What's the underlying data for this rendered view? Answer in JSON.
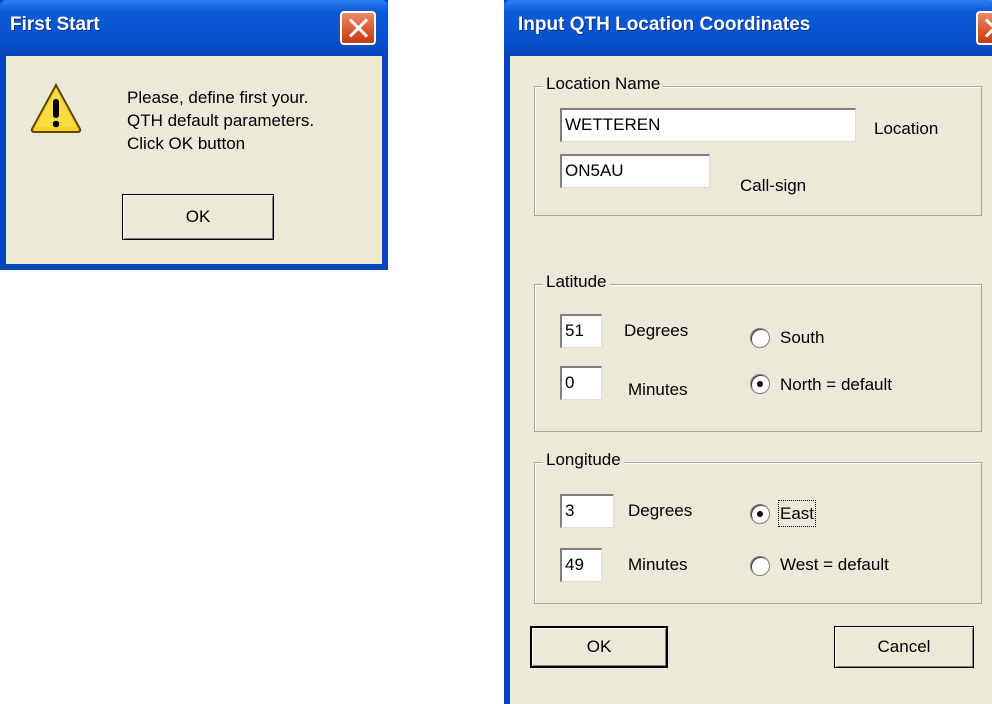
{
  "dialog1": {
    "title": "First Start",
    "message": [
      "Please, define first your.",
      "QTH default parameters.",
      "Click OK button"
    ],
    "ok_label": "OK"
  },
  "dialog2": {
    "title": "Input QTH Location Coordinates",
    "location_group": {
      "legend": "Location Name",
      "location_value": "WETTEREN",
      "location_label": "Location",
      "callsign_value": "ON5AU",
      "callsign_label": "Call-sign"
    },
    "latitude_group": {
      "legend": "Latitude",
      "degrees_value": "51",
      "degrees_label": "Degrees",
      "minutes_value": "0",
      "minutes_label": "Minutes",
      "south_label": "South",
      "north_label": "North = default",
      "selected": "north"
    },
    "longitude_group": {
      "legend": "Longitude",
      "degrees_value": "3",
      "degrees_label": "Degrees",
      "minutes_value": "49",
      "minutes_label": "Minutes",
      "east_label": "East",
      "west_label": "West = default",
      "selected": "east"
    },
    "ok_label": "OK",
    "cancel_label": "Cancel"
  }
}
